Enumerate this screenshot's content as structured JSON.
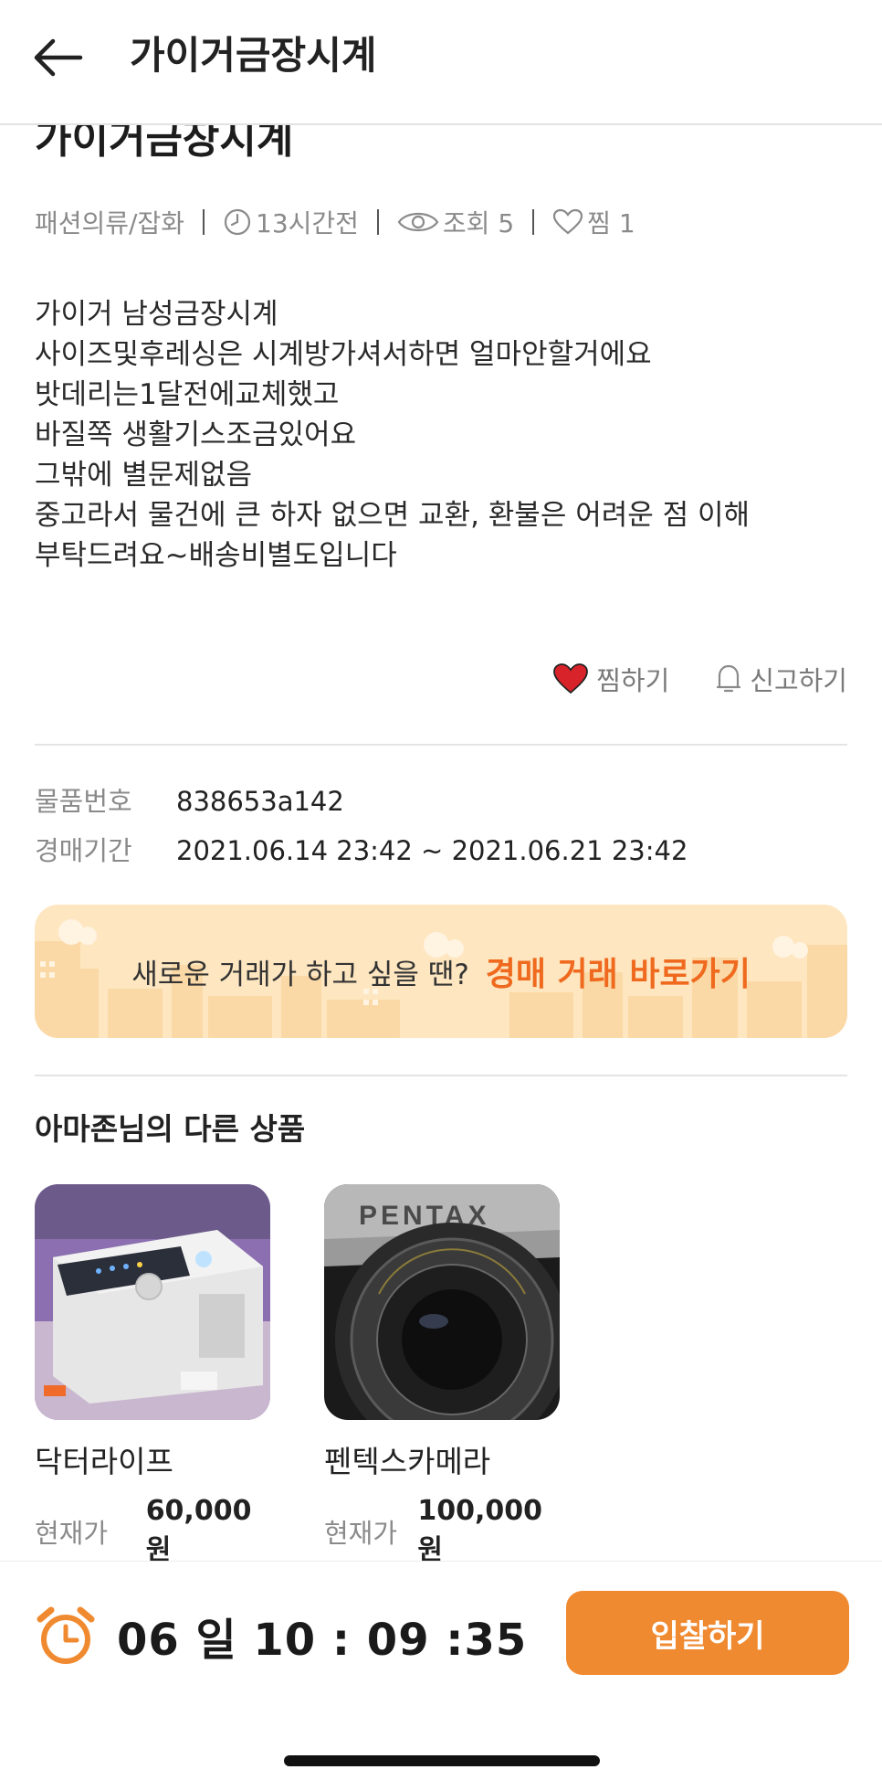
{
  "header": {
    "title": "가이거금장시계",
    "back_icon": "arrow-left-icon"
  },
  "item": {
    "title": "가이거금장시계",
    "category": "패션의류/잡화",
    "time_ago": "13시간전",
    "views_label": "조회 5",
    "likes_label": "찜 1",
    "description": "가이거 남성금장시계\n사이즈및후레싱은 시계방가셔서하면 얼마안할거에요\n밧데리는1달전에교체했고\n바질쪽 생활기스조금있어요\n그밖에 별문제없음\n중고라서 물건에 큰 하자 없으면 교환, 환불은 어려운 점 이해\n부탁드려요~배송비별도입니다"
  },
  "actions": {
    "like_label": "찜하기",
    "report_label": "신고하기",
    "like_color": "#d8232a"
  },
  "info": {
    "number_label": "물품번호",
    "number_value": "838653a142",
    "period_label": "경매기간",
    "period_value": "2021.06.14 23:42 ~ 2021.06.21 23:42"
  },
  "banner": {
    "text": "새로운 거래가 하고 싶을 땐?",
    "link": "경매 거래 바로가기",
    "accent": "#ef6a1f"
  },
  "other_products": {
    "title": "아마존님의 다른 상품",
    "items": [
      {
        "name": "닥터라이프",
        "price_label": "현재가",
        "price": "60,000원"
      },
      {
        "name": "펜텍스카메라",
        "price_label": "현재가",
        "price": "100,000원",
        "brand_text": "PENTAX"
      }
    ]
  },
  "bottom": {
    "timer": "06 일 10 : 09 :35",
    "bid_label": "입찰하기",
    "accent": "#f08a30",
    "alarm_icon": "alarm-clock-icon"
  }
}
